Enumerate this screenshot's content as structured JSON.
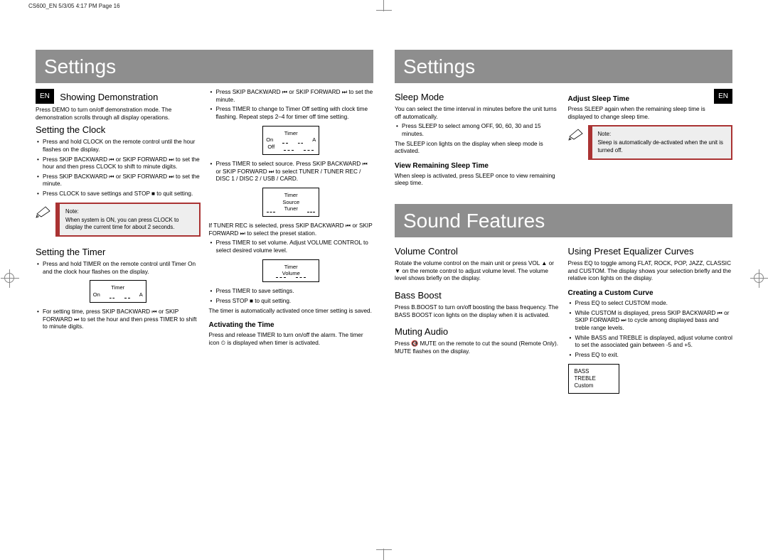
{
  "meta": {
    "header": "CS600_EN  5/3/05  4:17 PM  Page 16"
  },
  "left": {
    "title": "Settings",
    "lang": "EN",
    "sec1": {
      "h": "Showing Demonstration",
      "p1": "Press DEMO to turn on/off demonstration mode. The demonstration scrolls through all display operations."
    },
    "sec2": {
      "h": "Setting the Clock",
      "l1": "Press and hold CLOCK on the remote control until the hour flashes on the display.",
      "l2": "Press SKIP BACKWARD ⏮ or SKIP FORWARD ⏭ to set the hour and then press CLOCK to shift to minute digits.",
      "l3": "Press SKIP BACKWARD ⏮ or SKIP FORWARD ⏭ to set the minute.",
      "l4": "Press CLOCK to save settings and STOP ■ to quit setting.",
      "note_label": "Note:",
      "note": "When system is ON, you can press CLOCK to display the current time for about 2 seconds."
    },
    "sec3": {
      "h": "Setting the Timer",
      "l1": "Press and hold TIMER on the remote control until Timer On and the clock hour flashes on the display.",
      "d1a": "Timer",
      "d1b": "On",
      "d1c": "A",
      "l2": "For setting time, press SKIP BACKWARD ⏮ or SKIP FORWARD ⏭ to set the hour and then press TIMER to shift to minute digits."
    },
    "col2": {
      "l1": "Press SKIP BACKWARD ⏮ or SKIP FORWARD ⏭ to set the minute.",
      "l2": "Press TIMER to change to Timer Off setting with clock time flashing. Repeat steps 2–4 for timer off time setting.",
      "d2a": "Timer",
      "d2b": "On",
      "d2c": "A",
      "d2d": "Off",
      "l3": "Press TIMER to select source. Press SKIP BACKWARD ⏮ or SKIP FORWARD ⏭ to select TUNER / TUNER REC / DISC 1 / DISC 2 / USB / CARD.",
      "d3a": "Timer",
      "d3b": "Source",
      "d3c": "Tuner",
      "l4": "If TUNER REC is selected, press SKIP BACKWARD ⏮ or SKIP FORWARD ⏭ to select the preset station.",
      "l5": "Press TIMER to set volume. Adjust VOLUME CONTROL to select desired volume level.",
      "d4a": "Timer",
      "d4b": "Volume",
      "l6": "Press TIMER to save settings.",
      "l7": "Press STOP ■ to quit setting.",
      "p1": "The timer is automatically activated once timer setting is saved.",
      "h2": "Activating the Time",
      "p2": "Press and release TIMER to turn on/off the alarm. The timer icon ⏲ is displayed when timer is activated."
    }
  },
  "right": {
    "title": "Settings",
    "lang": "EN",
    "sec1": {
      "h": "Sleep Mode",
      "p1": "You can select the time interval in minutes before the unit turns off automatically.",
      "l1": "Press SLEEP to select among OFF, 90, 60, 30 and 15 minutes.",
      "p2": "The SLEEP icon lights on the display when sleep mode is activated.",
      "h2": "View Remaining Sleep Time",
      "p3": "When sleep is activated, press SLEEP once to view remaining sleep time."
    },
    "sec2": {
      "h": "Adjust Sleep Time",
      "p1": "Press SLEEP again when the remaining sleep time is displayed to change sleep time.",
      "note_label": "Note:",
      "note": "Sleep is automatically de-activated when the unit is turned off."
    },
    "sf_title": "Sound Features",
    "sec3": {
      "h": "Volume Control",
      "p1": "Rotate the volume control on the main unit or press VOL ▲ or ▼ on the remote control to adjust volume level. The volume level shows briefly on the display."
    },
    "sec4": {
      "h": "Bass Boost",
      "p1": "Press B.BOOST to turn on/off boosting the bass frequency. The BASS BOOST icon lights on the display when it is activated."
    },
    "sec5": {
      "h": "Muting Audio",
      "p1": "Press 🔇 MUTE on the remote to cut the sound (Remote Only). MUTE flashes on the display."
    },
    "sec6": {
      "h": "Using Preset Equalizer Curves",
      "p1": "Press EQ to toggle among FLAT, ROCK, POP, JAZZ, CLASSIC and CUSTOM. The display shows your selection briefly and the relative icon lights on the display.",
      "h2": "Creating a Custom Curve",
      "l1": "Press EQ to select CUSTOM mode.",
      "l2": "While CUSTOM is displayed, press SKIP BACKWARD ⏮ or SKIP FORWARD ⏭ to cycle among displayed bass and treble range levels.",
      "l3": "While BASS and TREBLE is displayed, adjust volume control to set the associated gain between -5 and +5.",
      "l4": "Press EQ to exit.",
      "eq1": "BASS",
      "eq2": "TREBLE",
      "eq3": "Custom"
    }
  }
}
